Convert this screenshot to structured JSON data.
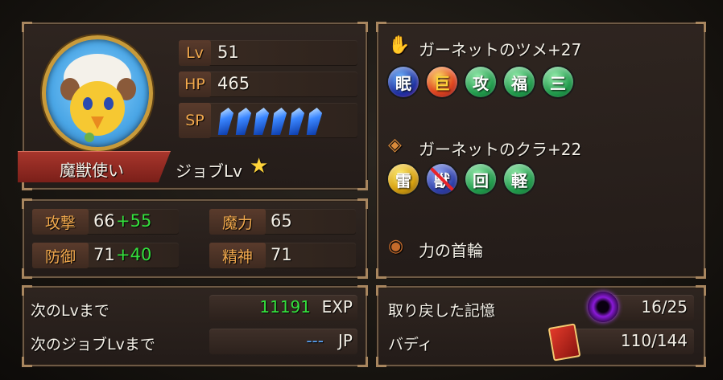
{
  "character": {
    "job_name": "魔獣使い",
    "job_level_label": "ジョブLv",
    "lv_label": "Lv",
    "lv_value": "51",
    "hp_label": "HP",
    "hp_value": "465",
    "sp_label": "SP",
    "sp_crystals": 6
  },
  "stats": {
    "attack_label": "攻撃",
    "attack_base": "66",
    "attack_bonus": "+55",
    "magic_label": "魔力",
    "magic_value": "65",
    "defense_label": "防御",
    "defense_base": "71",
    "defense_bonus": "+40",
    "spirit_label": "精神",
    "spirit_value": "71"
  },
  "equipment": {
    "weapon_name": "ガーネットのツメ+27",
    "weapon_orbs": [
      "眠",
      "巨",
      "攻",
      "福",
      "三"
    ],
    "armor_name": "ガーネットのクラ+22",
    "armor_orbs": [
      "雷",
      "獣",
      "回",
      "軽"
    ],
    "accessory_name": "力の首輪"
  },
  "progress": {
    "next_lv_label": "次のLvまで",
    "next_lv_value": "11191",
    "next_lv_unit": "EXP",
    "next_job_label": "次のジョブLvまで",
    "next_job_value": "---",
    "next_job_unit": "JP",
    "memory_label": "取り戻した記憶",
    "memory_value": "16/25",
    "buddy_label": "バディ",
    "buddy_value": "110/144"
  },
  "colors": {
    "accent_orange": "#f2a94d",
    "bonus_green": "#34e03d",
    "job_banner": "#8c2a22"
  }
}
